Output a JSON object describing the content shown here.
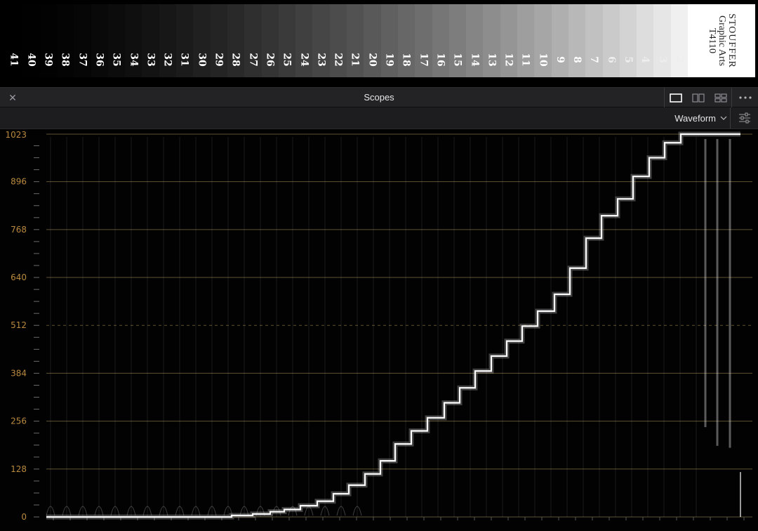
{
  "wedge": {
    "patch_labels": [
      "41",
      "40",
      "39",
      "38",
      "37",
      "36",
      "35",
      "34",
      "33",
      "32",
      "31",
      "30",
      "29",
      "28",
      "27",
      "26",
      "25",
      "24",
      "23",
      "22",
      "21",
      "20",
      "19",
      "18",
      "17",
      "16",
      "15",
      "14",
      "13",
      "12",
      "11",
      "10",
      "9",
      "8",
      "7",
      "6",
      "5",
      "4",
      "3",
      "2"
    ],
    "brand": {
      "line1": "STOUFFER",
      "line2": "Graphic Arts",
      "line3": "T4110"
    }
  },
  "panel": {
    "title": "Scopes",
    "close_icon": "close-icon",
    "layout_icons": [
      "single-view-icon",
      "dual-view-icon",
      "quad-view-icon"
    ],
    "more_icon": "more-icon"
  },
  "toolbar": {
    "scope_type": "Waveform",
    "dropdown_icon": "chevron-down-icon",
    "settings_icon": "sliders-icon"
  },
  "waveform": {
    "y_ticks": [
      "1023",
      "896",
      "768",
      "640",
      "512",
      "384",
      "256",
      "128",
      "0"
    ],
    "y_values": [
      1023,
      896,
      768,
      640,
      512,
      384,
      256,
      128,
      0
    ],
    "dashed_level": 512,
    "ymax": 1023,
    "grid_color": "#5e5232",
    "label_color": "#b8893e",
    "trace_color": "#ffffff"
  }
}
